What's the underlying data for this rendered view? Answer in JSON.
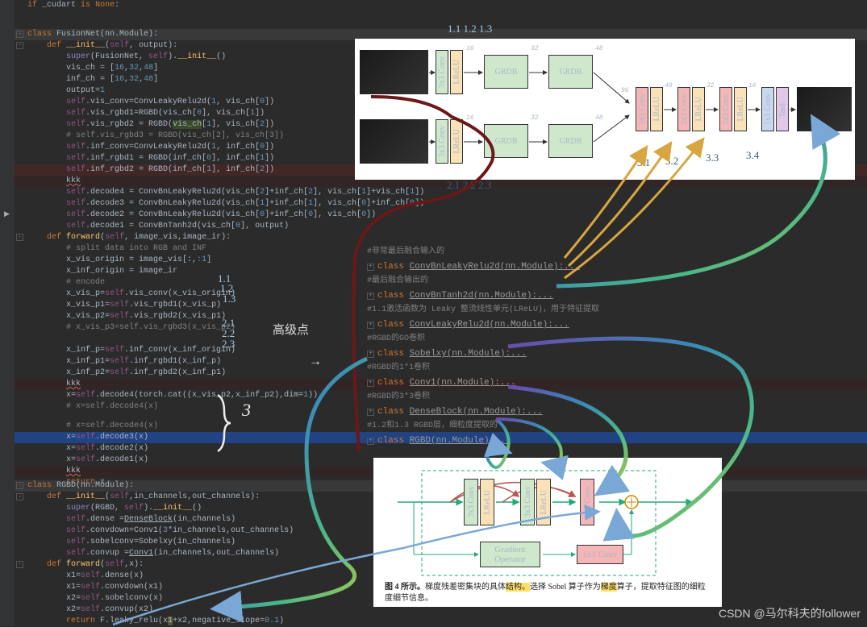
{
  "code_top": {
    "l00": "    if _cudart is None:",
    "l01": "class FusionNet(nn.Module):",
    "l02": "    def __init__(self, output):",
    "l03": "        super(FusionNet, self).__init__()",
    "l04": "        vis_ch = [16,32,48]",
    "l05": "        inf_ch = [16,32,48]",
    "l06": "        output=1",
    "l07": "        self.vis_conv=ConvLeakyRelu2d(1, vis_ch[0])",
    "l08": "        self.vis_rgbd1=RGBD(vis_ch[0], vis_ch[1])",
    "l09": "        self.vis_rgbd2 = RGBD(vis_ch[1], vis_ch[2])",
    "l10": "        # self.vis_rgbd3 = RGBD(vis_ch[2], vis_ch[3])",
    "l11": "        self.inf_conv=ConvLeakyRelu2d(1, inf_ch[0])",
    "l12": "        self.inf_rgbd1 = RGBD(inf_ch[0], inf_ch[1])",
    "l13": "        self.inf_rgbd2 = RGBD(inf_ch[1], inf_ch[2])",
    "l14": "        kkk",
    "l15": "        self.decode4 = ConvBnLeakyRelu2d(vis_ch[2]+inf_ch[2], vis_ch[1]+vis_ch[1])",
    "l16": "        self.decode3 = ConvBnLeakyRelu2d(vis_ch[1]+inf_ch[1], vis_ch[0]+inf_ch[0])",
    "l17": "        self.decode2 = ConvBnLeakyRelu2d(vis_ch[0]+inf_ch[0], vis_ch[0])",
    "l18": "        self.decode1 = ConvBnTanh2d(vis_ch[0], output)",
    "l19": "    def forward(self, image_vis,image_ir):",
    "l20": "        # split data into RGB and INF",
    "l21": "        x_vis_origin = image_vis[:,:1]",
    "l22": "        x_inf_origin = image_ir",
    "l23": "        # encode",
    "l24": "        x_vis_p=self.vis_conv(x_vis_origin)",
    "l25": "        x_vis_p1=self.vis_rgbd1(x_vis_p)",
    "l26": "        x_vis_p2=self.vis_rgbd2(x_vis_p1)",
    "l27": "        # x_vis_p3=self.vis_rgbd3(x_vis_p2)",
    "l28": "        ",
    "l29": "        x_inf_p=self.inf_conv(x_inf_origin)",
    "l30": "        x_inf_p1=self.inf_rgbd1(x_inf_p)",
    "l31": "        x_inf_p2=self.inf_rgbd2(x_inf_p1)",
    "l32": "        kkk",
    "l33": "        x=self.decode4(torch.cat((x_vis_p2,x_inf_p2),dim=1))",
    "l34": "        # x=self.decode4(x)",
    "l35": "",
    "l36": "        # x=self.decode4(x)",
    "l37": "        x=self.decode3(x)",
    "l38": "        x=self.decode2(x)",
    "l39": "        x=self.decode1(x)",
    "l40": "        kkk",
    "l41": "        return x"
  },
  "code_bottom": {
    "l00": "class RGBD(nn.Module):",
    "l01": "    def __init__(self,in_channels,out_channels):",
    "l02": "        super(RGBD, self).__init__()",
    "l03": "        self.dense =DenseBlock(in_channels)",
    "l04": "        self.convdown=Conv1(3*in_channels,out_channels)",
    "l05": "        self.sobelconv=Sobelxy(in_channels)",
    "l06": "        self.convup =Conv1(in_channels,out_channels)",
    "l07": "    def forward(self,x):",
    "l08": "        x1=self.dense(x)",
    "l09": "        x1=self.convdown(x1)",
    "l10": "        x2=self.sobelconv(x)",
    "l11": "        x2=self.convup(x2)",
    "l12": "        return F.leaky_relu(x1+x2,negative_slope=0.1)"
  },
  "annotations": {
    "top1": "1.1   1.2        1.3",
    "side1_1": "1.1",
    "side1_2": "1.2",
    "side1_3": "1.3",
    "side2_1": "2.1",
    "side2_2": "2.2",
    "side2_3": "2.3",
    "mid_row": "2.1  2.2   2.3",
    "d31": "3.1",
    "d32": "3.2",
    "d33": "3.3",
    "d34": "3.4",
    "gaojidian": "高级点",
    "brace3": "3",
    "arrow": "→"
  },
  "diagram1": {
    "conv": "3x3 Conv",
    "lrelu": "LReLU",
    "grdb": "GRDB",
    "onebyone": "1x1 Conv",
    "tanh": "Tanh",
    "n16": "16",
    "n32": "32",
    "n48": "48",
    "n96": "96"
  },
  "diagram2": {
    "conv": "3x3 Conv",
    "lrelu": "LReLU",
    "onec": "1x1 Conv",
    "grad": "Gradient\nOperator",
    "caption": "图 4 所示。梯度残差密集块的具体结构。选择 Sobel 算子作为梯度算子，提取特征图的细粒度细节信息。"
  },
  "classlist": {
    "c0": "#非常最后融合输入的",
    "c1": "class ConvBnLeakyRelu2d(nn.Module):...",
    "c2": "#最后融合输出的",
    "c3": "class ConvBnTanh2d(nn.Module):...",
    "c4": "#1.1激活函数为 Leaky 整流线性单元(LReLU)，用于特征提取",
    "c5": "class ConvLeakyRelu2d(nn.Module):...",
    "c6": "#RGBD的GO卷积",
    "c7": "class Sobelxy(nn.Module):...",
    "c8": "#RGBD的1*1卷积",
    "c9": "class Conv1(nn.Module):...",
    "c10": "#RGBD的3*3卷积",
    "c11": "class DenseBlock(nn.Module):...",
    "c12": "#1.2和1.3 RGBD层，细粒度提取的",
    "c13": "class RGBD(nn.Module):..."
  },
  "watermark": "CSDN @马尔科夫的follower"
}
